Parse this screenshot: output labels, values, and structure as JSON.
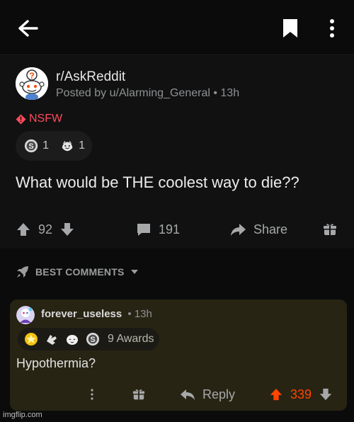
{
  "toolbar": {
    "back_icon": "arrow-left-icon",
    "bookmark_icon": "bookmark-icon",
    "more_icon": "vertical-dots-icon"
  },
  "post": {
    "subreddit": "r/AskReddit",
    "posted_by": "Posted by u/Alarming_General • 13h",
    "nsfw_label": "NSFW",
    "awards": [
      {
        "icon": "silver-award-icon",
        "count": "1"
      },
      {
        "icon": "wholesome-award-icon",
        "count": "1"
      }
    ],
    "title": "What would be THE coolest way to die??",
    "upvotes": "92",
    "comments": "191",
    "share_label": "Share"
  },
  "sort": {
    "label": "BEST COMMENTS",
    "icon": "rocket-icon"
  },
  "comment": {
    "username": "forever_useless",
    "time": "• 13h",
    "awards_label": "9 Awards",
    "award_icons": [
      "gold-star-award-icon",
      "hand-award-icon",
      "face-award-icon",
      "silver-award-icon"
    ],
    "body": "Hypothermia?",
    "reply_label": "Reply",
    "score": "339"
  },
  "colors": {
    "background": "#0b0b0b",
    "post_bg": "#111111",
    "comment_bg": "#282414",
    "nsfw": "#ff4a5c",
    "upvote_active": "#ff4500"
  },
  "watermark": "imgflip.com"
}
